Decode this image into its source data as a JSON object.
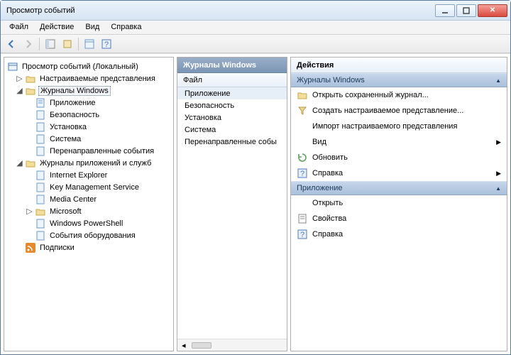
{
  "title": "Просмотр событий",
  "menubar": {
    "file": "Файл",
    "action": "Действие",
    "view": "Вид",
    "help": "Справка"
  },
  "tree": {
    "root": "Просмотр событий (Локальный)",
    "custom_views": "Настраиваемые представления",
    "win_logs": "Журналы Windows",
    "win_children": {
      "app": "Приложение",
      "sec": "Безопасность",
      "setup": "Установка",
      "sys": "Система",
      "fwd": "Перенаправленные события"
    },
    "app_logs": "Журналы приложений и служб",
    "app_children": {
      "ie": "Internet Explorer",
      "kms": "Key Management Service",
      "mc": "Media Center",
      "ms": "Microsoft",
      "ps": "Windows PowerShell",
      "hw": "События оборудования"
    },
    "subs": "Подписки"
  },
  "middle": {
    "header": "Журналы Windows",
    "col": "Файл",
    "items": {
      "app": "Приложение",
      "sec": "Безопасность",
      "setup": "Установка",
      "sys": "Система",
      "fwd": "Перенаправленные собы"
    }
  },
  "actions": {
    "header": "Действия",
    "group1": "Журналы Windows",
    "g1_items": {
      "open_saved": "Открыть сохраненный журнал...",
      "create_view": "Создать настраиваемое представление...",
      "import_view": "Импорт настраиваемого представления",
      "view": "Вид",
      "refresh": "Обновить",
      "help": "Справка"
    },
    "group2": "Приложение",
    "g2_items": {
      "open": "Открыть",
      "props": "Свойства",
      "help": "Справка"
    }
  }
}
